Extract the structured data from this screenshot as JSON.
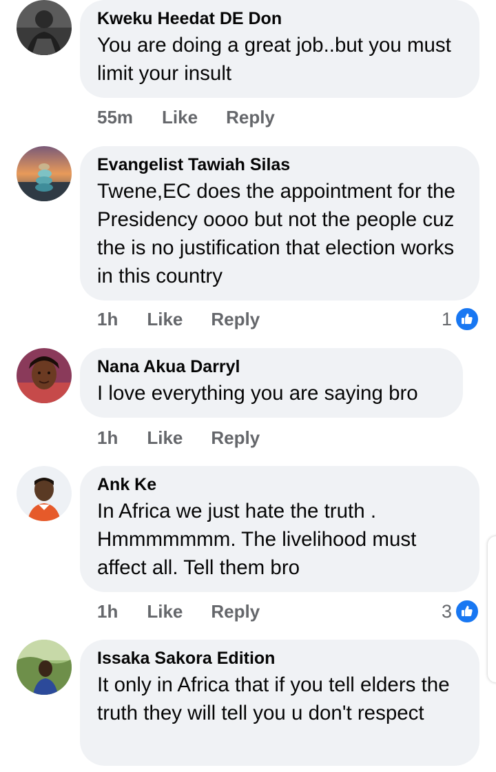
{
  "actions": {
    "like": "Like",
    "reply": "Reply"
  },
  "colors": {
    "bubble": "#f0f2f5",
    "meta": "#65676b",
    "like_blue": "#1877f2"
  },
  "comments": [
    {
      "author": "Kweku Heedat DE Don",
      "text": "You are doing a great job..but you must limit your insult",
      "time": "55m"
    },
    {
      "author": "Evangelist Tawiah Silas",
      "text": "Twene,EC does the appointment for the Presidency oooo but not the people cuz the is no justification that election works in this country",
      "time": "1h",
      "reactions": "1",
      "reaction_icon": "thumbs-up-icon"
    },
    {
      "author": "Nana Akua Darryl",
      "text": "I love everything you are saying bro",
      "time": "1h"
    },
    {
      "author": "Ank Ke",
      "text": "In Africa we just hate the truth . Hmmmmmmm. The livelihood must affect all. Tell them bro",
      "time": "1h",
      "reactions": "3",
      "reaction_icon": "thumbs-up-icon"
    },
    {
      "author": "Issaka Sakora Edition",
      "text": "It only in Africa that if you tell elders the truth they will tell you u don't respect"
    }
  ]
}
